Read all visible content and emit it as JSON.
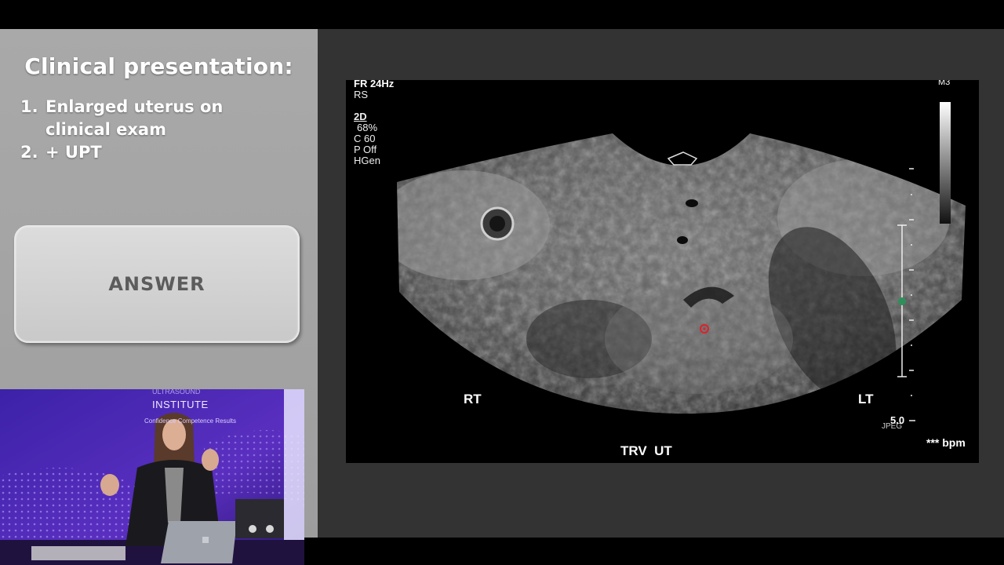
{
  "slide": {
    "title": "Clinical presentation:",
    "points": [
      {
        "num": "1.",
        "line1": "Enlarged uterus on",
        "line2": "clinical exam"
      },
      {
        "num": "2.",
        "line1": "+ UPT",
        "line2": ""
      }
    ],
    "answer_label": "ANSWER"
  },
  "ultrasound": {
    "header": "FR 24Hz",
    "preset": "RS",
    "mode": "2D",
    "gain": "68%",
    "compound": "C 60",
    "power": "P Off",
    "freq": "HGen",
    "map": "M3",
    "left_marker": "RT",
    "right_marker": "LT",
    "depth": "5.0",
    "format": "JPEG",
    "heart_rate": "*** bpm",
    "caption": "TRV  UT"
  },
  "webcam": {
    "brand_line1": "ULTRASOUND",
    "brand_line2": "INSTITUTE",
    "tagline1": "Confidence",
    "tagline2": "Competence",
    "tagline3": "Results"
  },
  "colors": {
    "panel_grey": "#a6a6a6",
    "viewer_bg": "#333333",
    "webcam_purple": "#5a2fc0",
    "marker_red": "#e0202a"
  }
}
